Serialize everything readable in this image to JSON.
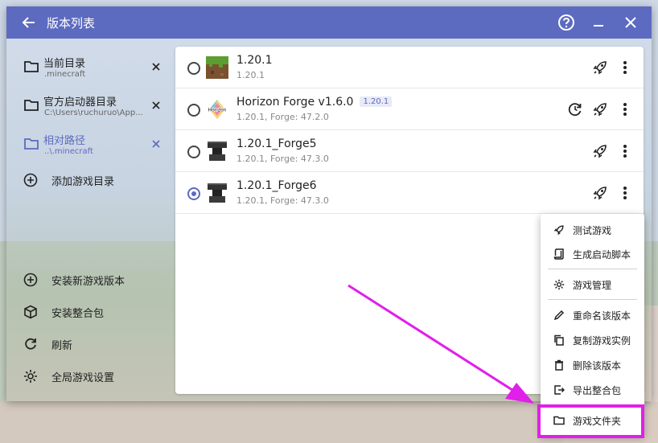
{
  "titlebar": {
    "title": "版本列表"
  },
  "sidebar": {
    "directories": [
      {
        "name": "当前目录",
        "path": ".minecraft",
        "selected": false
      },
      {
        "name": "官方启动器目录",
        "path": "C:\\Users\\ruchuruo\\App...",
        "selected": false
      },
      {
        "name": "相对路径",
        "path": "..\\.minecraft",
        "selected": true
      }
    ],
    "add_dir_label": "添加游戏目录",
    "actions": [
      {
        "label": "安装新游戏版本",
        "icon": "plus-circle-icon"
      },
      {
        "label": "安装整合包",
        "icon": "package-icon"
      },
      {
        "label": "刷新",
        "icon": "refresh-icon"
      },
      {
        "label": "全局游戏设置",
        "icon": "gear-icon"
      }
    ]
  },
  "versions": [
    {
      "name": "1.20.1",
      "tag": "",
      "sub": "1.20.1",
      "icon": "grass-block-icon",
      "selected": false,
      "has_update": false
    },
    {
      "name": "Horizon Forge v1.6.0",
      "tag": "1.20.1",
      "sub": "1.20.1, Forge: 47.2.0",
      "icon": "horizon-logo-icon",
      "selected": false,
      "has_update": true
    },
    {
      "name": "1.20.1_Forge5",
      "tag": "",
      "sub": "1.20.1, Forge: 47.3.0",
      "icon": "anvil-icon",
      "selected": false,
      "has_update": false
    },
    {
      "name": "1.20.1_Forge6",
      "tag": "",
      "sub": "1.20.1, Forge: 47.3.0",
      "icon": "anvil-icon",
      "selected": true,
      "has_update": false
    }
  ],
  "context_menu": {
    "items": [
      {
        "label": "测试游戏",
        "icon": "rocket-icon"
      },
      {
        "label": "生成启动脚本",
        "icon": "script-icon"
      },
      {
        "label": "游戏管理",
        "icon": "gear-icon"
      },
      {
        "label": "重命名该版本",
        "icon": "pencil-icon"
      },
      {
        "label": "复制游戏实例",
        "icon": "copy-icon"
      },
      {
        "label": "删除该版本",
        "icon": "trash-icon"
      },
      {
        "label": "导出整合包",
        "icon": "export-icon"
      },
      {
        "label": "游戏文件夹",
        "icon": "folder-icon"
      }
    ]
  },
  "colors": {
    "accent": "#5c6bc0",
    "highlight": "#e020e8"
  }
}
